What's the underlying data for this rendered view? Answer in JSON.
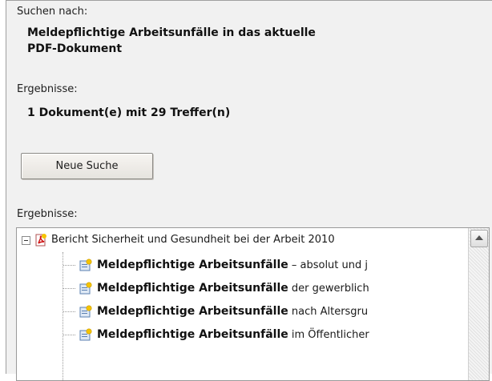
{
  "search": {
    "label": "Suchen nach:",
    "query_line1": "Meldepflichtige Arbeitsunfälle in das aktuelle",
    "query_line2": "PDF-Dokument"
  },
  "results_summary": {
    "label": "Ergebnisse:",
    "value": "1 Dokument(e) mit 29 Treffer(n)"
  },
  "new_search_button": "Neue Suche",
  "results_list": {
    "label": "Ergebnisse:",
    "document": "Bericht Sicherheit und Gesundheit bei der Arbeit 2010",
    "items": [
      {
        "bold": "Meldepflichtige Arbeitsunfälle",
        "rest": " – absolut und j"
      },
      {
        "bold": "Meldepflichtige Arbeitsunfälle",
        "rest": " der gewerblich"
      },
      {
        "bold": "Meldepflichtige Arbeitsunfälle",
        "rest": " nach Altersgru"
      },
      {
        "bold": "Meldepflichtige Arbeitsunfälle",
        "rest": " im Öffentlicher"
      }
    ]
  },
  "icons": {
    "document": "pdf-document-icon",
    "result": "search-hit-icon",
    "expander": "tree-collapse-icon",
    "scroll_up": "scroll-up-arrow-icon"
  }
}
